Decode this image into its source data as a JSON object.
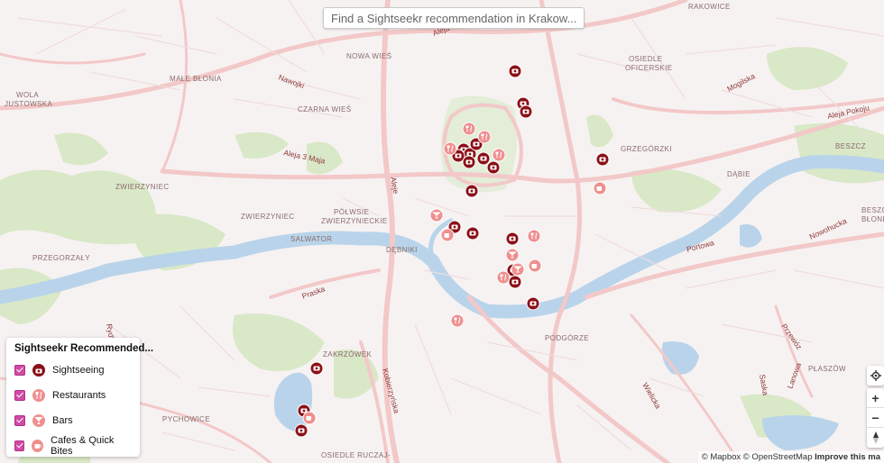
{
  "search": {
    "placeholder": "Find a Sightseekr recommendation in Krakow..."
  },
  "legend": {
    "title": "Sightseekr Recommended...",
    "items": [
      {
        "label": "Sightseeing",
        "icon": "camera-icon",
        "color": "#8b0f17",
        "checked": true
      },
      {
        "label": "Restaurants",
        "icon": "fork-knife-icon",
        "color": "#ef8f8f",
        "checked": true
      },
      {
        "label": "Bars",
        "icon": "cocktail-icon",
        "color": "#ef8f8f",
        "checked": true
      },
      {
        "label": "Cafes & Quick Bites",
        "icon": "coffee-cup-icon",
        "color": "#ef8f8f",
        "checked": true
      }
    ]
  },
  "districts": [
    "RAKOWICE",
    "NOWA WIEŚ",
    "OSIEDLE",
    "OFICERSKIE",
    "MAŁE BŁONIA",
    "WOLA",
    "JUSTOWSKA",
    "CZARNA WIEŚ",
    "GRZEGÓRZKI",
    "DĄBIE",
    "BESZCZ",
    "ZWIERZYNIEC",
    "PÓŁWSIE",
    "ZWIERZYNIECKIE",
    "SALWATOR",
    "DĘBNIKI",
    "PRZEGORZAŁY",
    "PODGÓRZE",
    "PŁASZÓW",
    "ZAKRZÓWEK",
    "PYCHOWICE",
    "OSIEDLE RUCZAJ-",
    "BŁONIA"
  ],
  "roads": [
    "Aleja",
    "Nawojki",
    "Aleja 3 Maja",
    "Aleje",
    "Praska",
    "Kobierzyńska",
    "Wielicka",
    "Portowa",
    "Przewóz",
    "Saska",
    "Lanowa",
    "Nowohucka",
    "Aleja Pokoju",
    "Mogilska",
    "Rydla"
  ],
  "controls": {
    "locate_icon": "crosshair-icon",
    "zoom_in": "+",
    "zoom_out": "−",
    "compass_icon": "compass-icon"
  },
  "attribution": {
    "text": "© Mapbox © OpenStreetMap",
    "improve": "Improve this ma"
  },
  "colors": {
    "sightseeing": "#8b0f17",
    "food": "#ef8f8f",
    "river": "#b8d3e8",
    "park": "#d8e7c4",
    "road": "#f3c9c9"
  }
}
